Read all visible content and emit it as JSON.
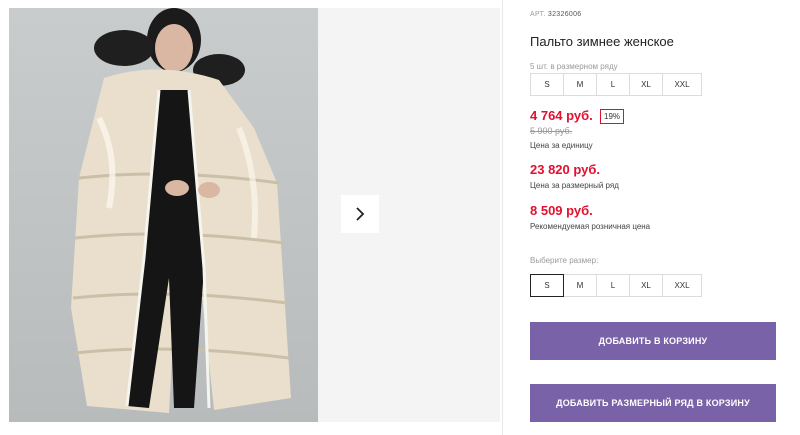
{
  "product": {
    "sku_label": "АРТ.",
    "sku": "32326006",
    "title": "Пальто зимнее женское"
  },
  "range": {
    "label": "5 шт. в размерном ряду",
    "sizes": [
      "S",
      "M",
      "L",
      "XL",
      "XXL"
    ]
  },
  "prices": {
    "unit_price": "4 764 руб.",
    "discount": "19%",
    "old_price": "5 900 руб.",
    "unit_note": "Цена за единицу",
    "range_price": "23 820 руб.",
    "range_note": "Цена за размерный ряд",
    "retail_price": "8 509 руб.",
    "retail_note": "Рекомендуемая розничная цена"
  },
  "size_select": {
    "label": "Выберите размер:",
    "selected": "S",
    "sizes": [
      "S",
      "M",
      "L",
      "XL",
      "XXL"
    ]
  },
  "buttons": {
    "add_to_cart": "ДОБАВИТЬ В КОРЗИНУ",
    "add_range": "ДОБАВИТЬ РАЗМЕРНЫЙ РЯД В КОРЗИНУ"
  },
  "gallery": {
    "next_icon": "chevron-right-icon"
  },
  "colors": {
    "price_red": "#e30f2f",
    "button_purple": "#7a62a8"
  }
}
